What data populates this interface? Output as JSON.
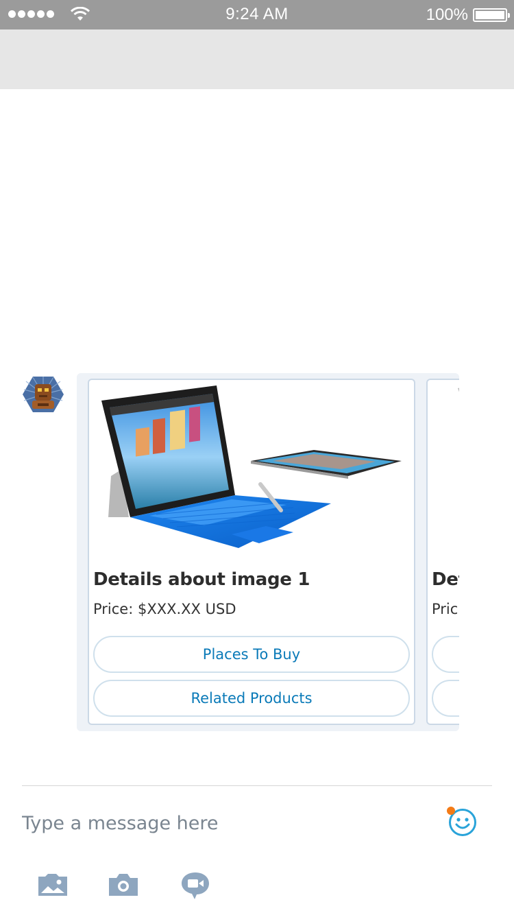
{
  "status_bar": {
    "time": "9:24 AM",
    "battery": "100%",
    "signal_icon": "signal-dots-icon",
    "wifi_icon": "wifi-icon",
    "battery_icon": "battery-icon"
  },
  "message": {
    "avatar_icon": "bot-avatar-icon",
    "cards": [
      {
        "image_icon": "surface-tablet-image",
        "title": "Details about image 1",
        "price": "Price: $XXX.XX USD",
        "buttons": [
          "Places To Buy",
          "Related Products"
        ]
      },
      {
        "image_icon": "surface-device-image",
        "title": "Det",
        "price": "Pric"
      }
    ]
  },
  "composer": {
    "placeholder": "Type a message here",
    "emoji_icon": "emoji-icon",
    "toolbar_icons": [
      "gallery-icon",
      "camera-icon",
      "video-call-icon"
    ]
  },
  "colors": {
    "status_bar": "#9b9b9b",
    "nav_bar": "#e6e6e6",
    "button_text": "#0a7ab8",
    "button_border": "#cfe0ec",
    "card_border": "#cbd8e6",
    "toolbar_icon": "#8ea6bf",
    "emoji": "#29a3d9",
    "notification_dot": "#f47b16"
  }
}
